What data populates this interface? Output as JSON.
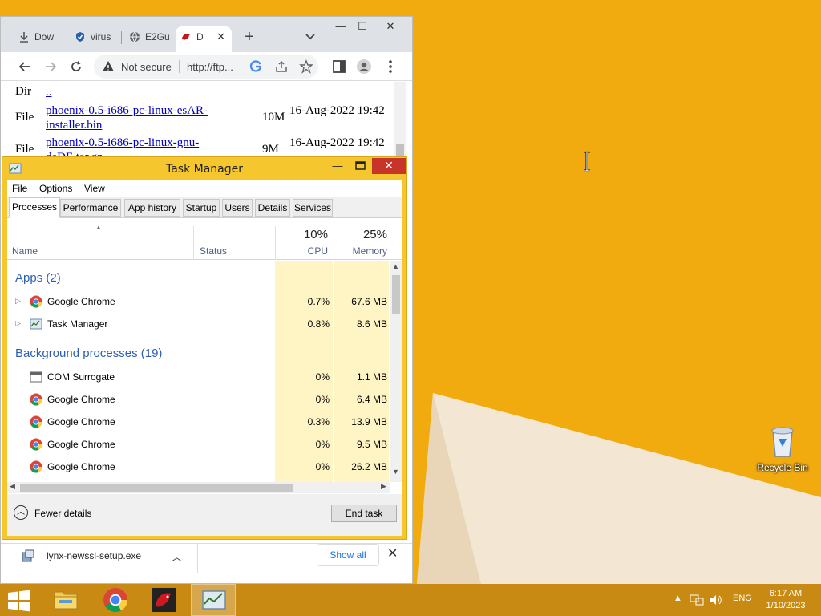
{
  "browser": {
    "tabs": [
      {
        "label": "Dow",
        "icon": "download-icon"
      },
      {
        "label": "virus",
        "icon": "shield-icon"
      },
      {
        "label": "E2Gu",
        "icon": "globe-icon"
      },
      {
        "label": "D",
        "icon": "dragonfly-icon"
      }
    ],
    "new_tab": "+",
    "address": {
      "security": "Not secure",
      "url": "http://ftp..."
    },
    "listing": {
      "rows": [
        {
          "type": "Dir",
          "name": "..",
          "size": "",
          "date": ""
        },
        {
          "type": "File",
          "name": "phoenix-0.5-i686-pc-linux-esAR-installer.bin",
          "size": "10M",
          "date": "16-Aug-2022 19:42"
        },
        {
          "type": "File",
          "name": "phoenix-0.5-i686-pc-linux-gnu-deDE.tar.gz",
          "size": "9M",
          "date": "16-Aug-2022 19:42"
        }
      ]
    },
    "download_bar": {
      "filename": "lynx-newssl-setup.exe",
      "show_all": "Show all"
    }
  },
  "task_manager": {
    "title": "Task Manager",
    "menu": [
      "File",
      "Options",
      "View"
    ],
    "tabs": [
      "Processes",
      "Performance",
      "App history",
      "Startup",
      "Users",
      "Details",
      "Services"
    ],
    "active_tab": "Processes",
    "columns": {
      "name": "Name",
      "status": "Status",
      "cpu": {
        "percent": "10%",
        "label": "CPU"
      },
      "memory": {
        "percent": "25%",
        "label": "Memory"
      }
    },
    "groups": [
      {
        "label": "Apps (2)",
        "processes": [
          {
            "name": "Google Chrome",
            "icon": "chrome-icon",
            "cpu": "0.7%",
            "memory": "67.6 MB",
            "expandable": true
          },
          {
            "name": "Task Manager",
            "icon": "task-manager-icon",
            "cpu": "0.8%",
            "memory": "8.6 MB",
            "expandable": true
          }
        ]
      },
      {
        "label": "Background processes (19)",
        "processes": [
          {
            "name": "COM Surrogate",
            "icon": "window-icon",
            "cpu": "0%",
            "memory": "1.1 MB",
            "expandable": false
          },
          {
            "name": "Google Chrome",
            "icon": "chrome-icon",
            "cpu": "0%",
            "memory": "6.4 MB",
            "expandable": false
          },
          {
            "name": "Google Chrome",
            "icon": "chrome-icon",
            "cpu": "0.3%",
            "memory": "13.9 MB",
            "expandable": false
          },
          {
            "name": "Google Chrome",
            "icon": "chrome-icon",
            "cpu": "0%",
            "memory": "9.5 MB",
            "expandable": false
          },
          {
            "name": "Google Chrome",
            "icon": "chrome-icon",
            "cpu": "0%",
            "memory": "26.2 MB",
            "expandable": false
          }
        ]
      }
    ],
    "fewer_details": "Fewer details",
    "end_task": "End task"
  },
  "desktop": {
    "recycle_bin": "Recycle Bin",
    "wallpaper_color": "#f2ab0f"
  },
  "taskbar": {
    "tray_lang": "ENG",
    "time": "6:17 AM",
    "date": "1/10/2023",
    "color": "#c88a12"
  }
}
